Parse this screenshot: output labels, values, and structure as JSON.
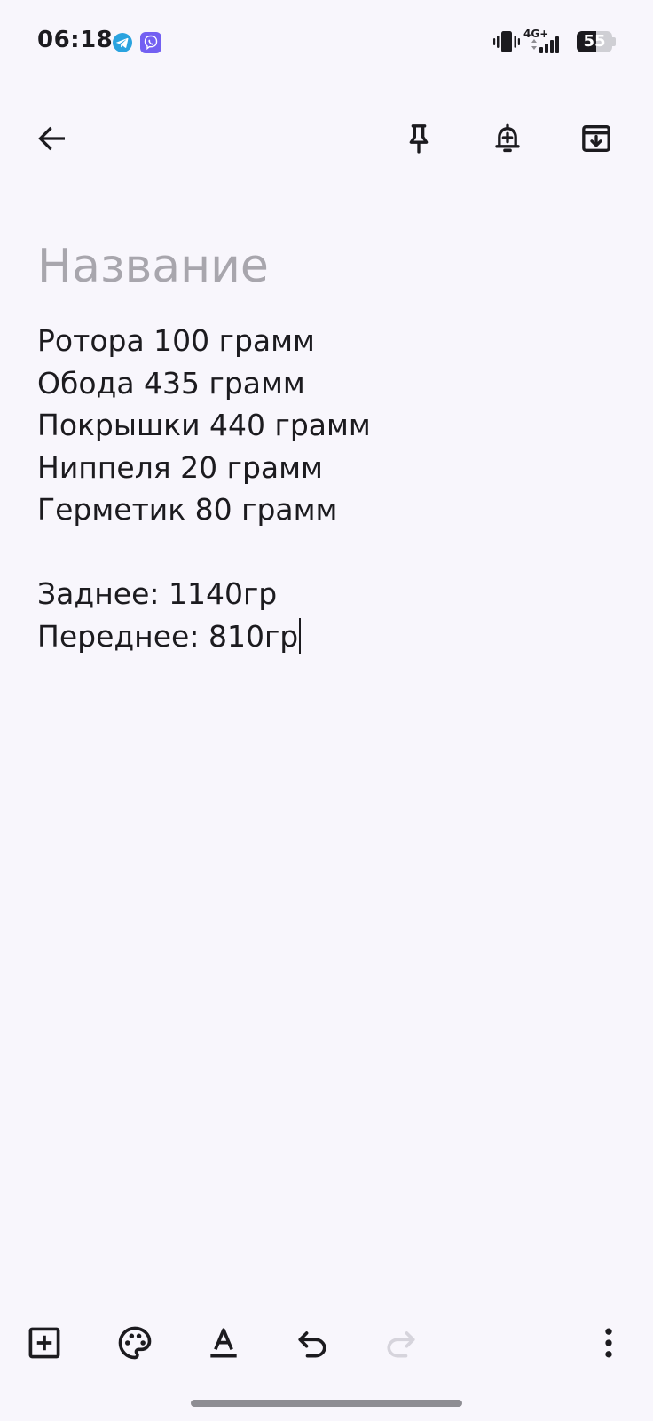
{
  "status_bar": {
    "time": "06:18",
    "network": "4G+",
    "battery": "55",
    "battery_level": 0.55
  },
  "toolbar": {
    "back_icon": "arrow-left-icon",
    "pin_icon": "pin-icon",
    "reminder_icon": "bell-plus-icon",
    "archive_icon": "archive-icon"
  },
  "note": {
    "title_placeholder": "Название",
    "title_value": "",
    "lines": [
      "Ротора 100 грамм",
      "Обода 435 грамм",
      "Покрышки 440 грамм",
      "Ниппеля 20 грамм",
      "Герметик 80 грамм",
      "",
      "Заднее: 1140гр",
      "Переднее: 810гр"
    ]
  },
  "bottom_bar": {
    "add_icon": "add-box-icon",
    "palette_icon": "palette-icon",
    "text_format_icon": "text-format-icon",
    "undo_icon": "undo-icon",
    "redo_icon": "redo-icon",
    "more_icon": "more-vert-icon"
  },
  "colors": {
    "background": "#f8f6fc",
    "text": "#1c1b1f",
    "placeholder": "#a8a6ad",
    "disabled_icon": "#d6d4dc",
    "telegram": "#2aa3df",
    "viber": "#7360f2"
  }
}
